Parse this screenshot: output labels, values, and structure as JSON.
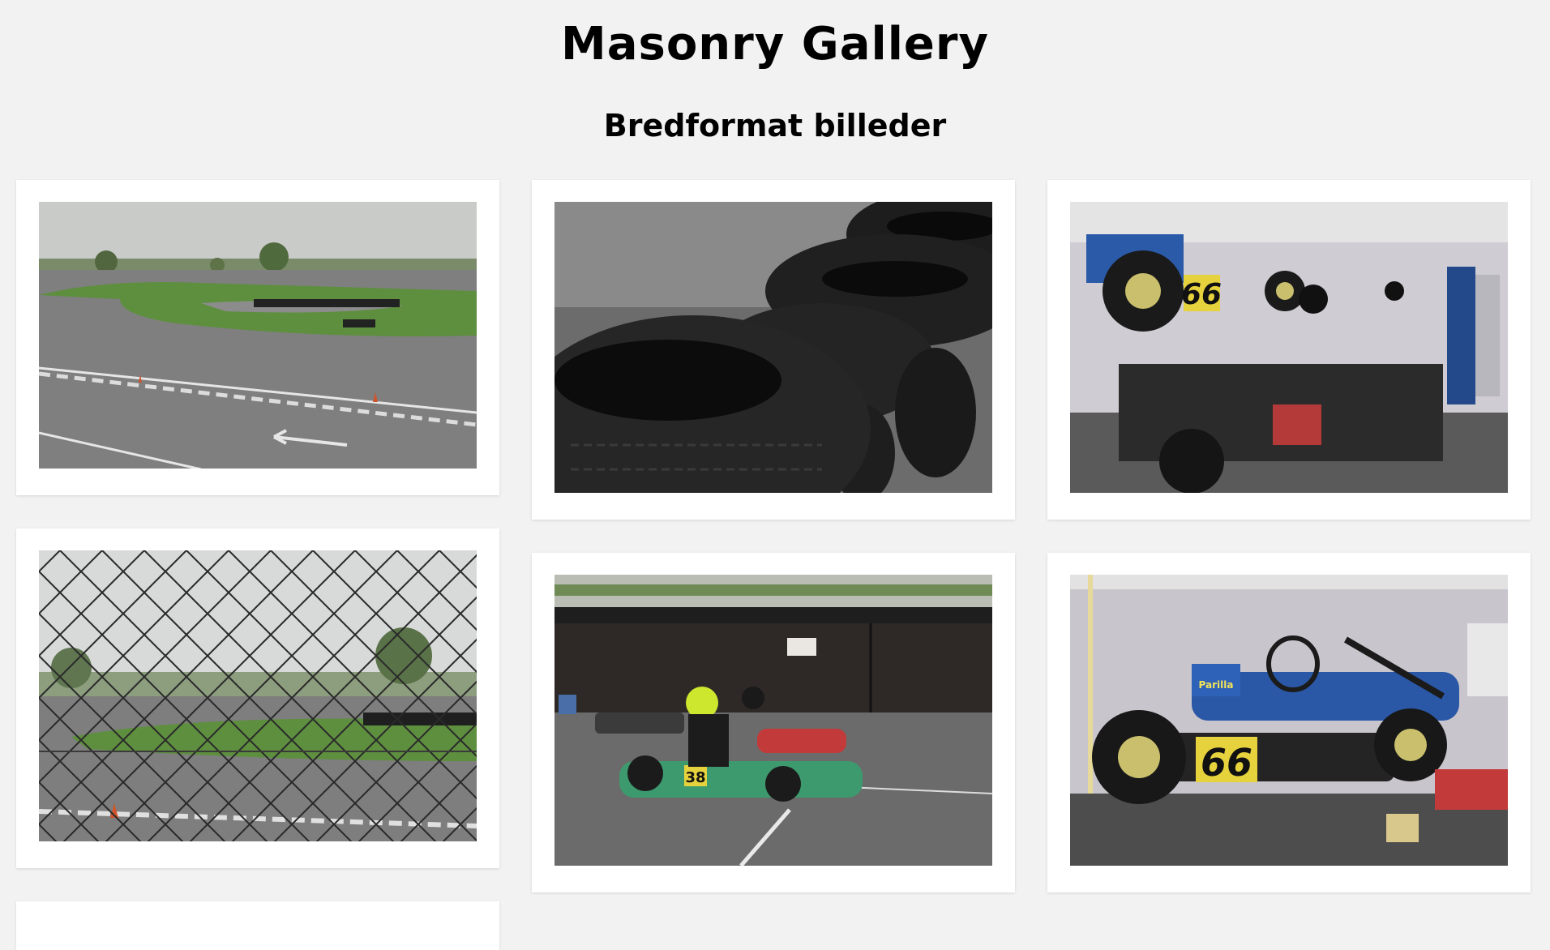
{
  "page": {
    "title": "Masonry Gallery",
    "subtitle": "Bredformat billeder"
  },
  "gallery": {
    "items": [
      {
        "subject": "kart-track-curve"
      },
      {
        "subject": "stacked-tires"
      },
      {
        "subject": "karts-garage-66"
      },
      {
        "subject": "track-behind-fence"
      },
      {
        "subject": "karts-pit-lane-38"
      },
      {
        "subject": "kart-66-closeup"
      },
      {
        "subject": "partial-next-card"
      }
    ]
  },
  "photo_labels": {
    "kart_38": "38",
    "kart_66": "66",
    "kart_66_b": "66",
    "brand": "Parilla"
  }
}
